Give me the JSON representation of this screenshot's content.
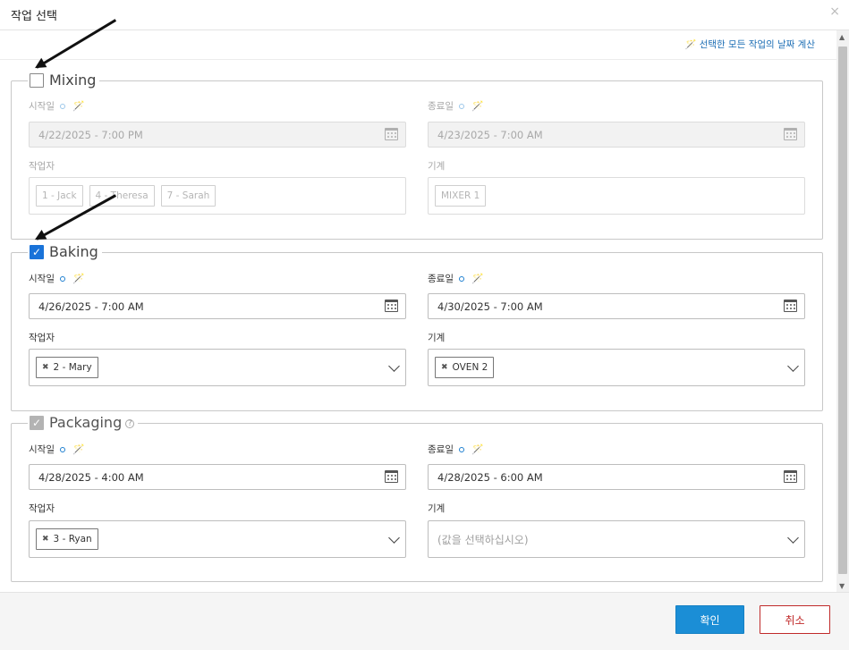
{
  "dialog": {
    "title": "작업 선택",
    "close_glyph": "×"
  },
  "calc_all_label": "선택한 모든 작업의 날짜 계산",
  "labels": {
    "start": "시작일",
    "end": "종료일",
    "worker": "작업자",
    "machine": "기계"
  },
  "sections": [
    {
      "name": "Mixing",
      "checked": false,
      "start": "4/22/2025 - 7:00 PM",
      "end": "4/23/2025 - 7:00 AM",
      "workers": [
        "1 - Jack",
        "4 - Theresa",
        "7 - Sarah"
      ],
      "machines": [
        "MIXER 1"
      ]
    },
    {
      "name": "Baking",
      "checked": true,
      "start": "4/26/2025 - 7:00 AM",
      "end": "4/30/2025 - 7:00 AM",
      "workers": [
        "2 - Mary"
      ],
      "machines": [
        "OVEN 2"
      ]
    },
    {
      "name": "Packaging",
      "checked": true,
      "start": "4/28/2025 - 4:00 AM",
      "end": "4/28/2025 - 6:00 AM",
      "workers": [
        "3 - Ryan"
      ],
      "machines": [],
      "machine_placeholder": "(값을 선택하십시오)"
    }
  ],
  "footer": {
    "ok_label": "확인",
    "cancel_label": "취소"
  },
  "colors": {
    "accent": "#1b8ed6",
    "checkbox_on": "#1a73d9",
    "cancel": "#c02a2a"
  }
}
